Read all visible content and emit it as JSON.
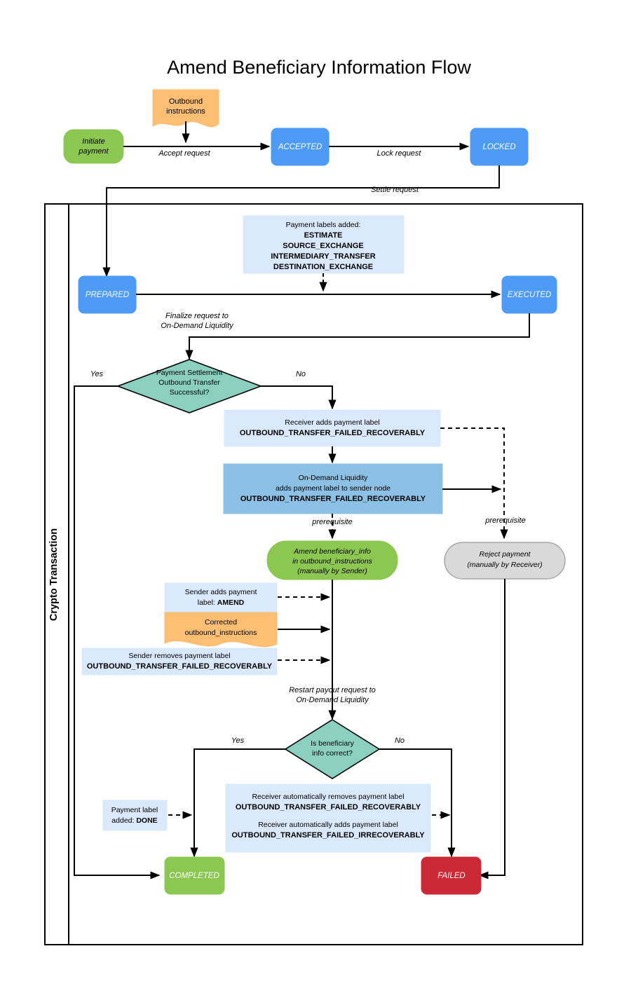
{
  "title": "Amend Beneficiary Information Flow",
  "swimlane": {
    "label": "Crypto Transaction"
  },
  "colors": {
    "green": "#8CC751",
    "green_node": "#8CC751",
    "blue": "#4D9BF5",
    "light_blue": "#D9E8FB",
    "mid_blue": "#8CC0E4",
    "orange": "#FBBE72",
    "teal": "#8ACFC0",
    "grey": "#D9D9D9",
    "red": "#CC2936",
    "stroke": "#000000",
    "text_light": "#FFFFFF"
  },
  "nodes": {
    "initiate_payment": {
      "line1": "Initiate",
      "line2": "payment"
    },
    "outbound_instructions": {
      "line1": "Outbound",
      "line2": "instructions"
    },
    "accepted": {
      "label": "ACCEPTED"
    },
    "locked": {
      "label": "LOCKED"
    },
    "prepared": {
      "label": "PREPARED"
    },
    "executed": {
      "label": "EXECUTED"
    },
    "payment_labels_added": {
      "line1": "Payment labels added:",
      "line2": "ESTIMATE",
      "line3": "SOURCE_EXCHANGE",
      "line4": "INTERMEDIARY_TRANSFER",
      "line5": "DESTINATION_EXCHANGE"
    },
    "decision_settlement": {
      "line1": "Payment Settlement",
      "line2": "Outbound Transfer",
      "line3": "Successful?"
    },
    "receiver_adds_label": {
      "line1": "Receiver adds payment label",
      "line2": "OUTBOUND_TRANSFER_FAILED_RECOVERABLY"
    },
    "odl_adds_label": {
      "line1": "On-Demand Liquidity",
      "line2": "adds payment label to sender node",
      "line3": "OUTBOUND_TRANSFER_FAILED_RECOVERABLY"
    },
    "amend_beneficiary": {
      "line1": "Amend beneficiary_info",
      "line2": "in outbound_instructions",
      "line3": "(manually by Sender)"
    },
    "reject_payment": {
      "line1": "Reject payment",
      "line2": "(manually by Receiver)"
    },
    "sender_adds_amend": {
      "line1": "Sender adds payment",
      "line2_prefix": "label: ",
      "line2_bold": "AMEND"
    },
    "corrected_outbound": {
      "line1": "Corrected",
      "line2": "outbound_instructions"
    },
    "sender_removes_label": {
      "line1": "Sender removes payment label",
      "line2": "OUTBOUND_TRANSFER_FAILED_RECOVERABLY"
    },
    "decision_beneficiary": {
      "line1": "Is beneficiary",
      "line2": "info correct?"
    },
    "payment_label_done": {
      "line1": "Payment label",
      "line2_prefix": "added: ",
      "line2_bold": "DONE"
    },
    "receiver_auto_labels": {
      "line1": "Receiver automatically removes payment label",
      "line2": "OUTBOUND_TRANSFER_FAILED_RECOVERABLY",
      "line3": "Receiver automatically adds payment label",
      "line4": "OUTBOUND_TRANSFER_FAILED_IRRECOVERABLY"
    },
    "completed": {
      "label": "COMPLETED"
    },
    "failed": {
      "label": "FAILED"
    }
  },
  "edges": {
    "accept_request": "Accept request",
    "lock_request": "Lock request",
    "settle_request": "Settle request",
    "finalize_request_l1": "Finalize request to",
    "finalize_request_l2": "On-Demand Liquidity",
    "yes_settlement": "Yes",
    "no_settlement": "No",
    "prerequisite_left": "prerequisite",
    "prerequisite_right": "prerequisite",
    "restart_payout_l1": "Restart payout request to",
    "restart_payout_l2": "On-Demand Liquidity",
    "yes_beneficiary": "Yes",
    "no_beneficiary": "No"
  }
}
